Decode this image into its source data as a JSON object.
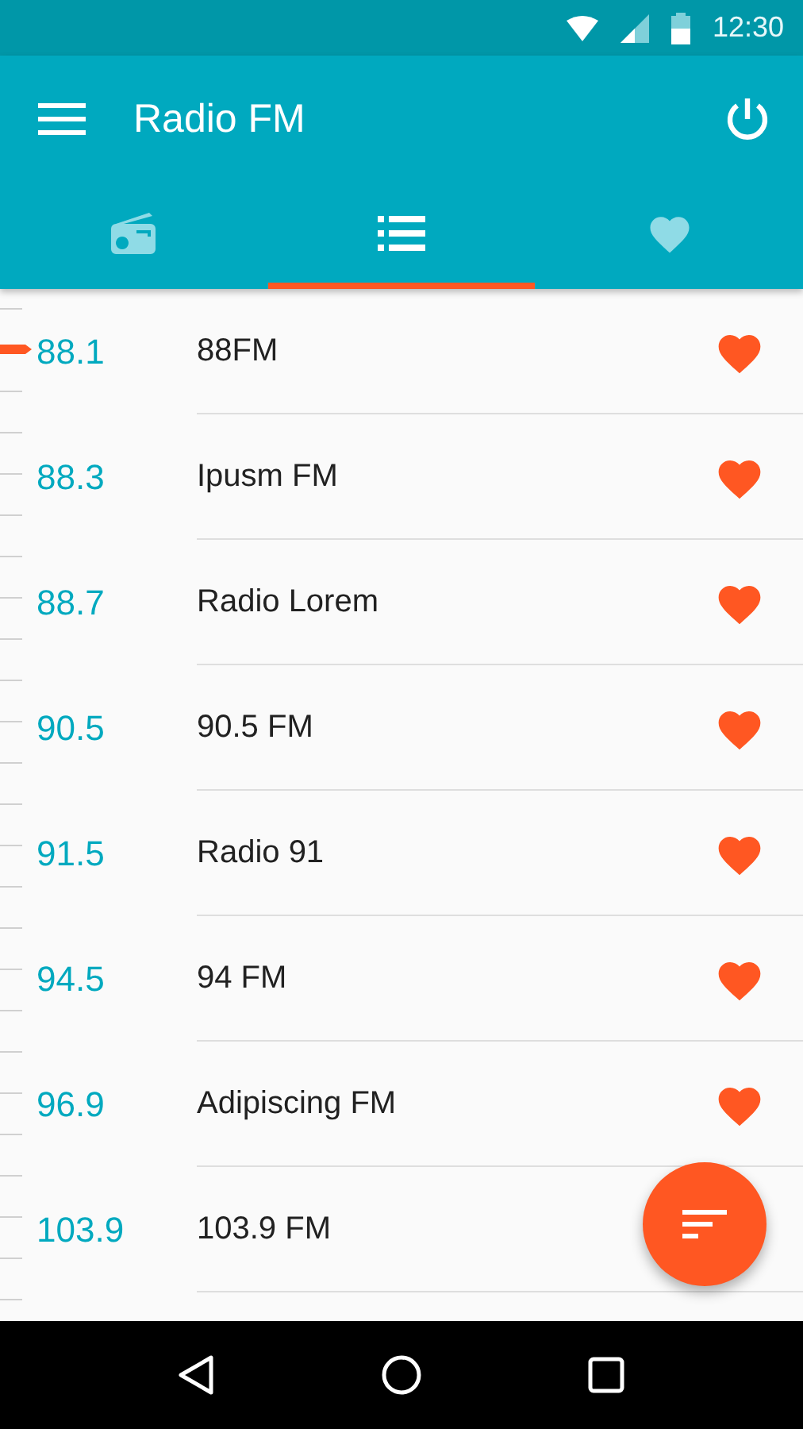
{
  "status_bar": {
    "time": "12:30"
  },
  "app_bar": {
    "title": "Radio FM"
  },
  "tabs": [
    {
      "kind": "radio",
      "selected": false
    },
    {
      "kind": "list",
      "selected": true
    },
    {
      "kind": "favorites",
      "selected": false
    }
  ],
  "stations": [
    {
      "frequency": "88.1",
      "name": "88FM",
      "favorite": true,
      "tuned": true
    },
    {
      "frequency": "88.3",
      "name": "Ipusm FM",
      "favorite": true,
      "tuned": false
    },
    {
      "frequency": "88.7",
      "name": "Radio Lorem",
      "favorite": true,
      "tuned": false
    },
    {
      "frequency": "90.5",
      "name": "90.5 FM",
      "favorite": true,
      "tuned": false
    },
    {
      "frequency": "91.5",
      "name": "Radio 91",
      "favorite": true,
      "tuned": false
    },
    {
      "frequency": "94.5",
      "name": "94 FM",
      "favorite": true,
      "tuned": false
    },
    {
      "frequency": "96.9",
      "name": "Adipiscing FM",
      "favorite": true,
      "tuned": false
    },
    {
      "frequency": "103.9",
      "name": "103.9 FM",
      "tuned": false
    }
  ]
}
